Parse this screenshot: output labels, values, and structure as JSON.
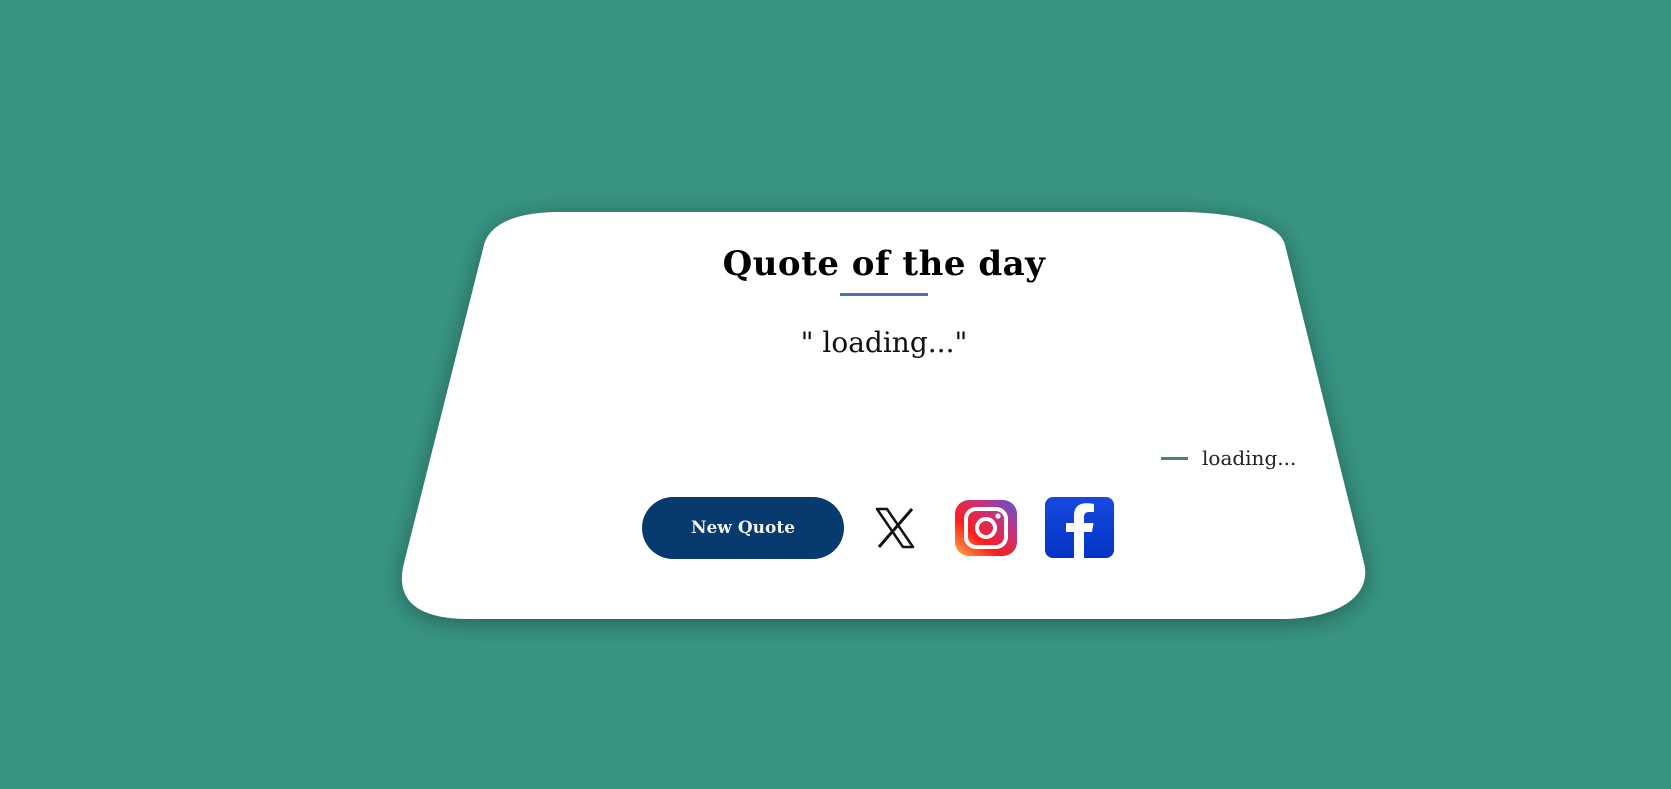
{
  "card": {
    "title": "Quote of the day",
    "quote": "\" loading...\"",
    "author": "loading..."
  },
  "actions": {
    "new_quote_label": "New Quote"
  },
  "social": {
    "icons": [
      "x-icon",
      "instagram-icon",
      "facebook-icon"
    ]
  },
  "colors": {
    "background": "#389482",
    "card": "#ffffff",
    "accent_underline": "#4b73b3",
    "author_dash": "#4a7f84",
    "button": "#073a6e",
    "facebook": "#0a3fd6"
  }
}
